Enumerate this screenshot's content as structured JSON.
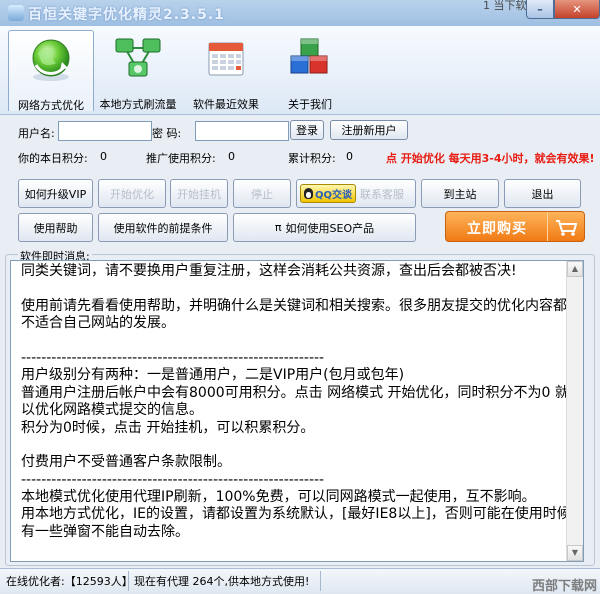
{
  "window": {
    "title": "百恒关键字优化精灵2.3.5.1",
    "minimize_glyph": "–",
    "close_glyph": "✕",
    "watermark_top": "1 当下软件园   装机博客"
  },
  "tabs": [
    {
      "label": "网络方式优化",
      "icon": "globe-refresh-icon",
      "active": true
    },
    {
      "label": "本地方式刷流量",
      "icon": "network-computers-icon",
      "active": false
    },
    {
      "label": "软件最近效果",
      "icon": "calendar-icon",
      "active": false
    },
    {
      "label": "关于我们",
      "icon": "colored-cubes-icon",
      "active": false
    }
  ],
  "login": {
    "username_label": "用户名:",
    "password_label": "密  码:",
    "username_value": "",
    "password_value": "",
    "login_button": "登录",
    "register_button": "注册新用户"
  },
  "stats": {
    "today_points_label": "你的本日积分:",
    "today_points_value": "0",
    "referral_points_label": "推广使用积分:",
    "referral_points_value": "0",
    "total_points_label": "累计积分:",
    "total_points_value": "0",
    "promo_text": "点 开始优化 每天用3-4小时，就会有效果!"
  },
  "buttons_row1": {
    "upgrade_vip": "如何升级VIP",
    "start_optimize": "开始优化",
    "start_hangup": "开始挂机",
    "stop": "停止",
    "qq_badge": "QQ交谈",
    "contact_service": "联系客服",
    "to_main_site": "到主站",
    "exit": "退出"
  },
  "buttons_row2": {
    "help": "使用帮助",
    "prerequisites": "使用软件的前提条件",
    "seo_pi": "π",
    "seo_howto": "如何使用SEO产品"
  },
  "buy": {
    "label": "立即购买",
    "icon": "shopping-cart-icon"
  },
  "messages": {
    "legend": "软件即时消息:",
    "lines": [
      "同类关键词，请不要换用户重复注册，这样会消耗公共资源，查出后会都被否决!",
      "",
      "使用前请先看看使用帮助，并明确什么是关键词和相关搜索。很多朋友提交的优化内容都很",
      "不适合自己网站的发展。",
      "",
      "------------------------------------------------------------",
      "用户级别分有两种：一是普通用户，二是VIP用户(包月或包年)",
      "普通用户注册后帐户中会有8000可用积分。点击 网络模式 开始优化，同时积分不为0 就可",
      "以优化网路模式提交的信息。",
      "积分为0时候，点击 开始挂机，可以积累积分。",
      "",
      "付费用户不受普通客户条款限制。",
      "------------------------------------------------------------",
      "本地模式优化使用代理IP刷新，100%免费，可以同网路模式一起使用，互不影响。",
      "用本地方式优化，IE的设置，请都设置为系统默认，[最好IE8以上]，否则可能在使用时候，",
      "有一些弹窗不能自动去除。"
    ]
  },
  "status": {
    "online_label": "在线优化者:",
    "online_count": "【12593人】",
    "proxy_text": "现在有代理 264个,供本地方式使用!",
    "watermark_bottom": "西部下载网"
  }
}
